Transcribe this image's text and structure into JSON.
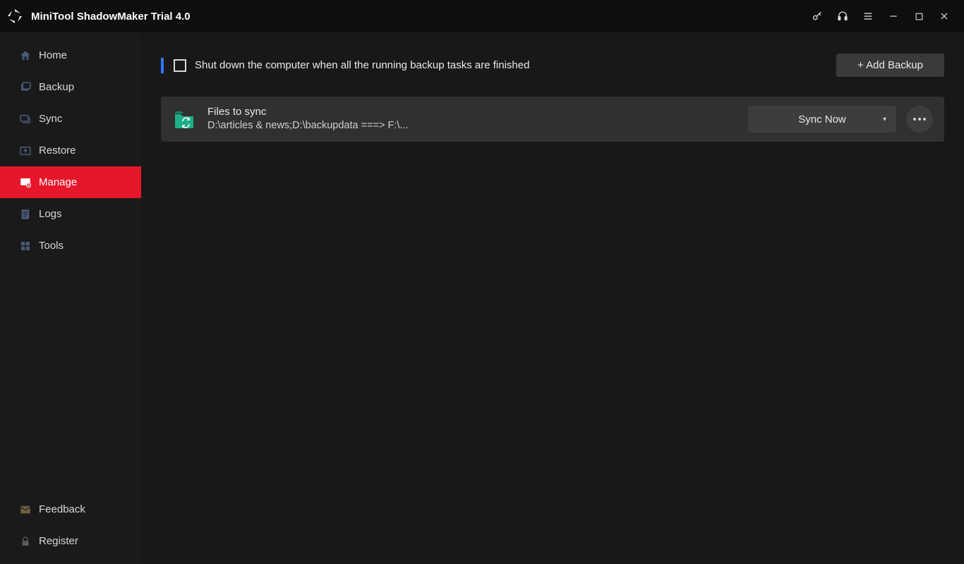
{
  "titlebar": {
    "title": "MiniTool ShadowMaker Trial 4.0"
  },
  "sidebar": {
    "items": [
      {
        "label": "Home",
        "active": false
      },
      {
        "label": "Backup",
        "active": false
      },
      {
        "label": "Sync",
        "active": false
      },
      {
        "label": "Restore",
        "active": false
      },
      {
        "label": "Manage",
        "active": true
      },
      {
        "label": "Logs",
        "active": false
      },
      {
        "label": "Tools",
        "active": false
      }
    ],
    "footer": [
      {
        "label": "Feedback"
      },
      {
        "label": "Register"
      }
    ]
  },
  "main": {
    "shutdown_label": "Shut down the computer when all the running backup tasks are finished",
    "shutdown_checked": false,
    "add_backup_label": "+ Add Backup",
    "tasks": [
      {
        "title": "Files to sync",
        "path": "D:\\articles & news;D:\\backupdata ===> F:\\...",
        "action_label": "Sync Now"
      }
    ]
  }
}
